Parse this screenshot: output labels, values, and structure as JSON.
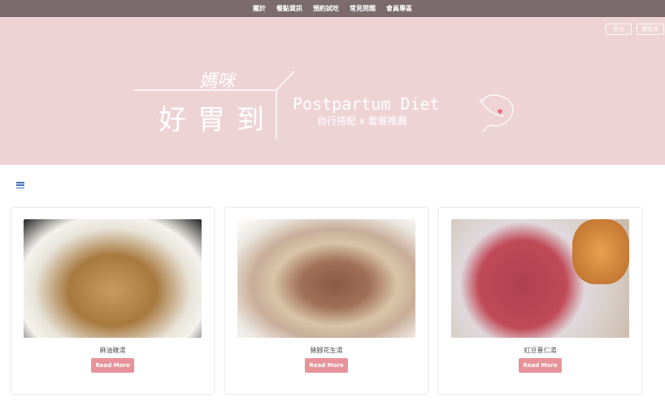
{
  "nav": {
    "items": [
      "關於",
      "餐點資訊",
      "預約試吃",
      "常見問題",
      "會員專區"
    ]
  },
  "header": {
    "logout": "登出",
    "cart": "購物車"
  },
  "logo": {
    "top": "媽咪",
    "main": "好胃到",
    "english": "Postpartum Diet",
    "sub": "自行搭配 x 套餐推薦"
  },
  "menu_icon": "hamburger-icon",
  "colors": {
    "nav": "#7b6b6d",
    "banner": "#eed3d5",
    "button": "#e8939a",
    "menu": "#3b6fb6"
  },
  "cards": [
    {
      "title": "麻油雞湯",
      "button": "Read More"
    },
    {
      "title": "豬腳花生湯",
      "button": "Read More"
    },
    {
      "title": "紅豆薏仁湯",
      "button": "Read More"
    }
  ]
}
